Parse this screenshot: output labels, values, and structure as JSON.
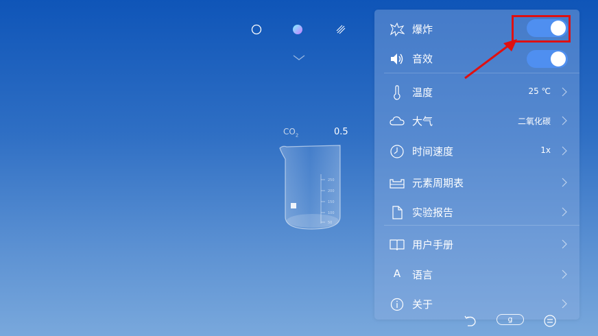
{
  "modes": {
    "icons": [
      "circle-outline-icon",
      "gradient-circle-icon",
      "hatched-circle-icon"
    ],
    "expand_icon": "chevron-down-icon"
  },
  "beaker": {
    "gas_label": "CO",
    "gas_subscript": "2",
    "value": "0.5",
    "graduations": [
      "250",
      "200",
      "150",
      "100",
      "50"
    ]
  },
  "settings": {
    "items": [
      {
        "icon": "explosion-icon",
        "label": "爆炸",
        "toggle_on": true
      },
      {
        "icon": "speaker-icon",
        "label": "音效",
        "toggle_on": true
      },
      {
        "icon": "thermometer-icon",
        "label": "温度",
        "value": "25 ℃"
      },
      {
        "icon": "cloud-icon",
        "label": "大气",
        "value": "二氧化碳"
      },
      {
        "icon": "clock-icon",
        "label": "时间速度",
        "value": "1x"
      },
      {
        "icon": "periodic-table-icon",
        "label": "元素周期表"
      },
      {
        "icon": "document-icon",
        "label": "实验报告"
      },
      {
        "icon": "book-icon",
        "label": "用户手册"
      },
      {
        "icon": "letter-a-icon",
        "label": "语言",
        "icon_text": "A"
      },
      {
        "icon": "info-icon",
        "label": "关于"
      }
    ]
  },
  "bottom_bar": {
    "undo_icon": "undo-icon",
    "g_label": "g",
    "menu_icon": "menu-icon"
  },
  "annotation": {
    "color": "#e01010"
  },
  "colors": {
    "toggle_on": "#4f8ff0",
    "background_top": "#0f55b8",
    "background_bottom": "#79a8dc"
  }
}
